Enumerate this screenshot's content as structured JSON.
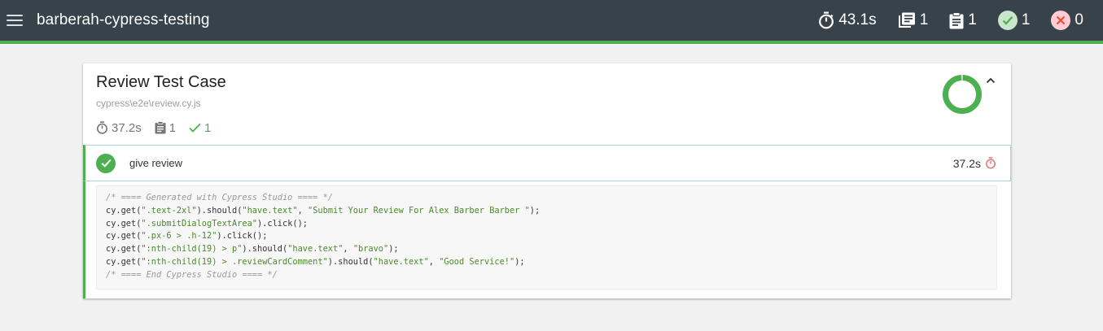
{
  "navbar": {
    "title": "barberah-cypress-testing",
    "stats": {
      "duration": "43.1s",
      "suites": "1",
      "tests": "1",
      "passes": "1",
      "failures": "0"
    }
  },
  "suite": {
    "title": "Review Test Case",
    "file": "cypress\\e2e\\review.cy.js",
    "duration": "37.2s",
    "tests": "1",
    "passes": "1",
    "pass_rate": 1.0,
    "colors": {
      "pass": "#4caf50",
      "border": "#a9d6e5"
    }
  },
  "test": {
    "title": "give review",
    "duration": "37.2s"
  },
  "code": [
    {
      "type": "comment",
      "text": "/* ==== Generated with Cypress Studio ==== */"
    },
    {
      "type": "code",
      "parts": [
        "cy.get(",
        "\".text-2xl\"",
        ").should(",
        "\"have.text\"",
        ", ",
        "\"Submit Your Review For Alex Barber Barber \"",
        ");"
      ]
    },
    {
      "type": "code",
      "parts": [
        "cy.get(",
        "\".submitDialogTextArea\"",
        ").click();"
      ]
    },
    {
      "type": "code",
      "parts": [
        "cy.get(",
        "\".px-6 > .h-12\"",
        ").click();"
      ]
    },
    {
      "type": "code",
      "parts": [
        "cy.get(",
        "\":nth-child(19) > p\"",
        ").should(",
        "\"have.text\"",
        ", ",
        "\"bravo\"",
        ");"
      ]
    },
    {
      "type": "code",
      "parts": [
        "cy.get(",
        "\":nth-child(19) > .reviewCardComment\"",
        ").should(",
        "\"have.text\"",
        ", ",
        "\"Good Service!\"",
        ");"
      ]
    },
    {
      "type": "comment",
      "text": "/* ==== End Cypress Studio ==== */"
    }
  ]
}
